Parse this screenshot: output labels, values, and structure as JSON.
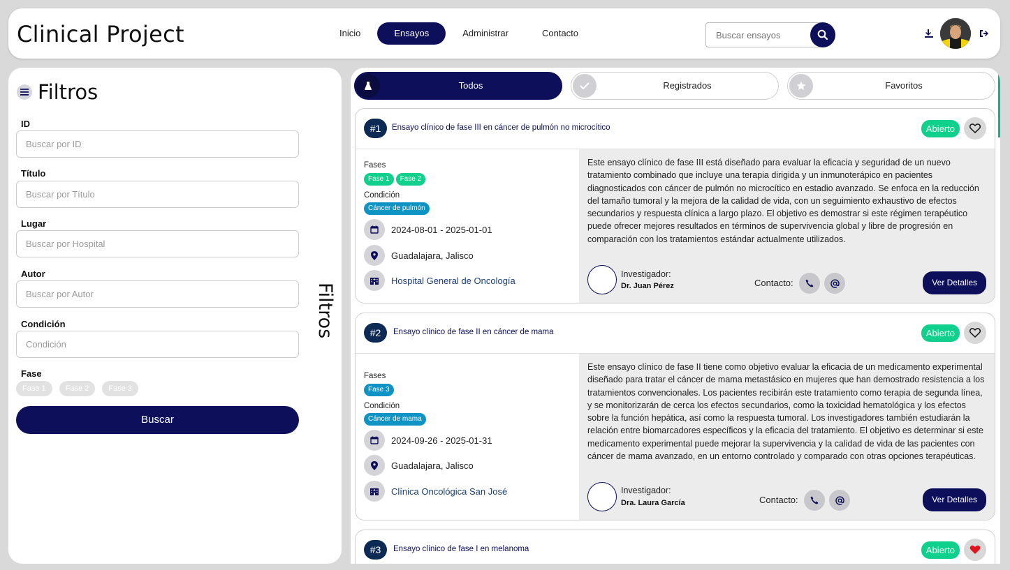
{
  "header": {
    "logo": "Clinical Project",
    "nav": [
      {
        "label": "Inicio",
        "active": false
      },
      {
        "label": "Ensayos",
        "active": true
      },
      {
        "label": "Administrar",
        "active": false
      },
      {
        "label": "Contacto",
        "active": false
      }
    ],
    "search_placeholder": "Buscar ensayos",
    "icons": [
      "search-icon",
      "download-icon",
      "user-avatar",
      "logout-icon"
    ]
  },
  "filters": {
    "title": "Filtros",
    "vertical_title": "Filtros",
    "fields": [
      {
        "label": "ID",
        "placeholder": "Buscar por ID"
      },
      {
        "label": "Título",
        "placeholder": "Buscar por Título"
      },
      {
        "label": "Lugar",
        "placeholder": "Buscar por Hospital"
      },
      {
        "label": "Autor",
        "placeholder": "Buscar por Autor"
      },
      {
        "label": "Condición",
        "placeholder": "Condición"
      }
    ],
    "phase_label": "Fase",
    "phases": [
      "Fase 1",
      "Fase 2",
      "Fase 3"
    ],
    "search_button": "Buscar"
  },
  "tabs": [
    {
      "label": "Todos",
      "icon": "flask-icon",
      "active": true
    },
    {
      "label": "Registrados",
      "icon": "check-icon",
      "active": false
    },
    {
      "label": "Favoritos",
      "icon": "star-icon",
      "active": false
    }
  ],
  "card_labels": {
    "phases": "Fases",
    "condition": "Condición",
    "investigator": "Investigador:",
    "contact": "Contacto:",
    "details": "Ver Detalles"
  },
  "trials": [
    {
      "number": "#1",
      "title": "Ensayo clínico de fase III en cáncer de pulmón no microcítico",
      "status": "Abierto",
      "favorite": false,
      "phases": [
        "Fase 1",
        "Fase 2"
      ],
      "condition": "Cáncer de pulmón",
      "dates": "2024-08-01 - 2025-01-01",
      "location": "Guadalajara, Jalisco",
      "hospital": "Hospital General de Oncología",
      "description": "Este ensayo clínico de fase III está diseñado para evaluar la eficacia y seguridad de un nuevo tratamiento combinado que incluye una terapia dirigida y un inmunoterápico en pacientes diagnosticados con cáncer de pulmón no microcítico en estadio avanzado. Se enfoca en la reducción del tamaño tumoral y la mejora de la calidad de vida, con un seguimiento exhaustivo de efectos secundarios y respuesta clínica a largo plazo. El objetivo es demostrar si este régimen terapéutico puede ofrecer mejores resultados en términos de supervivencia global y libre de progresión en comparación con los tratamientos estándar actualmente utilizados.",
      "investigator": "Dr. Juan Pérez"
    },
    {
      "number": "#2",
      "title": "Ensayo clínico de fase II en cáncer de mama",
      "status": "Abierto",
      "favorite": false,
      "phases": [
        "Fase 3"
      ],
      "condition": "Cáncer de mama",
      "dates": "2024-09-26 - 2025-01-31",
      "location": "Guadalajara, Jalisco",
      "hospital": "Clínica Oncológica San José",
      "description": "Este ensayo clínico de fase II tiene como objetivo evaluar la eficacia de un medicamento experimental diseñado para tratar el cáncer de mama metastásico en mujeres que han demostrado resistencia a los tratamientos convencionales. Los pacientes recibirán este tratamiento como terapia de segunda línea, y se monitorizarán de cerca los efectos secundarios, como la toxicidad hematológica y los efectos sobre la función hepática, así como la respuesta tumoral. Los investigadores también estudiarán la relación entre biomarcadores específicos y la eficacia del tratamiento. El objetivo es determinar si este medicamento experimental puede mejorar la supervivencia y la calidad de vida de las pacientes con cáncer de mama avanzado, en un entorno controlado y comparado con otras opciones terapéuticas.",
      "investigator": "Dra. Laura García"
    },
    {
      "number": "#3",
      "title": "Ensayo clínico de fase I en melanoma",
      "status": "Abierto",
      "favorite": true
    }
  ],
  "colors": {
    "primary": "#0d0f5a",
    "open_badge": "#10d08d",
    "condition_chip": "#0e94c4",
    "favorite_active": "#e0141e"
  }
}
